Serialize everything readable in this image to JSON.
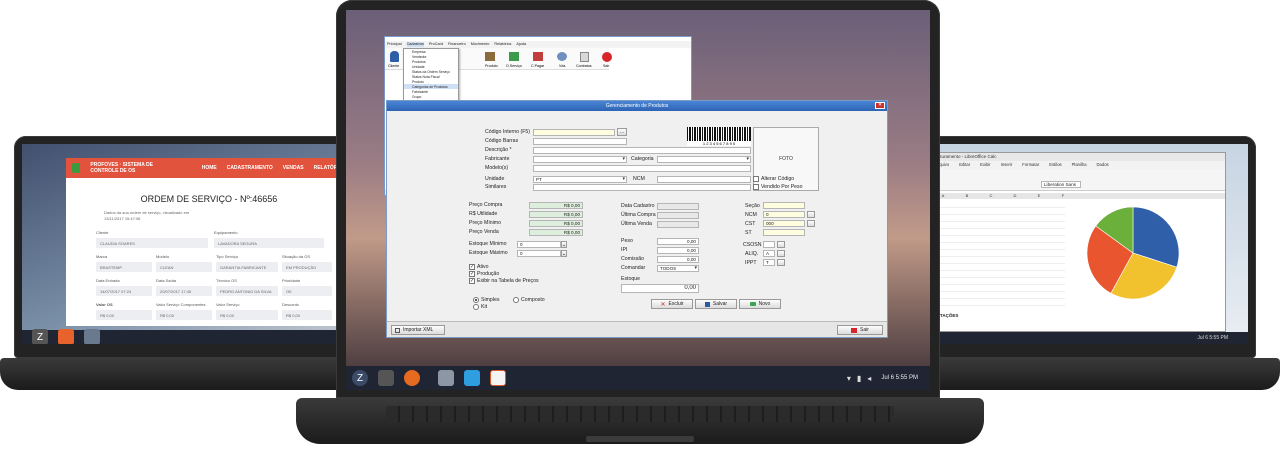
{
  "left_laptop": {
    "app": {
      "brand": "PROFOVES · SISTEMA DE CONTROLE DE OS",
      "nav": [
        "HOME",
        "CADASTRAMENTO",
        "VENDAS",
        "RELATÓRIOS"
      ],
      "title": "ORDEM DE SERVIÇO - Nº:46656",
      "subtitle": "Dados da sua ordem de serviço, visualizado em 13/11/2017 15:47:06",
      "fields": [
        {
          "label": "Cliente",
          "value": "CLAUDIA SOARES"
        },
        {
          "label": "Equipamento",
          "value": "LAVADORA SEGURA"
        },
        {
          "label": "Marca",
          "value": "BRASTEMP"
        },
        {
          "label": "Modelo",
          "value": "CLEAN"
        },
        {
          "label": "Tipo Serviço",
          "value": "GARANTIA FABRICANTE"
        },
        {
          "label": "Situação da OS",
          "value": "EM PRODUÇÃO"
        },
        {
          "label": "Data Entrada",
          "value": "14/07/2017 07:24"
        },
        {
          "label": "Data Saída",
          "value": "20/07/2017 17:45"
        },
        {
          "label": "Técnico OS",
          "value": "PEDRO ANTONIO DA SILVA"
        },
        {
          "label": "Prioridade",
          "value": "OK"
        },
        {
          "label": "Valor OS",
          "value": "R$ 0,00"
        },
        {
          "label": "Valor Serviço Componentes",
          "value": "R$ 0,00"
        },
        {
          "label": "Valor Serviço",
          "value": "R$ 0,00"
        },
        {
          "label": "Desconto",
          "value": "R$ 0,00"
        }
      ]
    }
  },
  "center_laptop": {
    "main_window": {
      "menu": [
        "Principal",
        "Cadastros",
        "ProCard",
        "Financeiro",
        "Movimento",
        "Relatórios",
        "Ajuda"
      ],
      "dropdown": [
        "Empresa",
        "Vendedor",
        "Produtos",
        "Unidade",
        "Status da Ordem Serviço",
        "Status Nota Fiscal",
        "Produto",
        "Categorias de Produtos",
        "Fabricante",
        "Grupo",
        "Tipo de Serviço",
        "Serviço"
      ],
      "toolbar": [
        "Cliente",
        "Produto",
        "O.Serviço",
        "C.Pagar",
        "Vda",
        "Contratos",
        "Sair"
      ],
      "status": "UN. MINAS CONTAS"
    },
    "dialog": {
      "title": "Gerenciamento de Produtos",
      "labels": {
        "codigo_interno": "Código Interno (F5)",
        "codigo_barras": "Código Barras",
        "descricao": "Descrição *",
        "fabricante": "Fabricante",
        "categoria": "Categoria",
        "modelo": "Modelo(s)",
        "unidade": "Unidade",
        "ncm": "NCM",
        "similares": "Similares",
        "foto": "FOTO",
        "barcode_number": "1 2 3 4 5 6 7 8 9 0",
        "alterar_codigo": "Alterar Código",
        "vendido_peso": "Vendido Por Peso",
        "preco_compra": "Preço Compra",
        "rs_utilidade": "R$ Utilidade",
        "preco_minimo": "Preço Mínimo",
        "preco_venda": "Preço Venda",
        "ultimo_cadastro": "Data Cadastro",
        "ultima_compra": "Última Compra",
        "ultima_venda": "Última Venda",
        "sessao": "Seção",
        "ncm2": "NCM",
        "cst": "CST",
        "st": "ST",
        "estoque_min": "Estoque Mínimo",
        "estoque_max": "Estoque Máximo",
        "peso": "Peso",
        "ipi": "IPI",
        "comissao": "Comissão",
        "comandar": "Comandar",
        "estoque": "Estoque",
        "cfop": "CSOSN",
        "icms": "ALIQ.",
        "ippt": "IPPT",
        "ativo": "Ativo",
        "producao": "Produção",
        "exibir_tabela": "Exibir na Tabela de Preços",
        "simples": "Simples",
        "composto": "Composto",
        "kit": "Kit",
        "importar_xml": "Importar XML"
      },
      "values": {
        "unidade": "PT",
        "preco_compra": "R$ 0,00",
        "rs_utilidade": "R$ 0,00",
        "preco_minimo": "R$ 0,00",
        "preco_venda": "R$ 0,00",
        "estoque_min": "0",
        "estoque_max": "0",
        "peso": "0,00",
        "ipi": "0,00",
        "comissao": "0,00",
        "comandar": "TODOS",
        "estoque": "0,00",
        "ncm2": "0",
        "cst": "000",
        "icms": "A",
        "ippt": "T"
      },
      "buttons": {
        "excluir": "Excluir",
        "salvar": "Salvar",
        "novo": "Novo",
        "sair": "Sair"
      }
    },
    "taskbar": {
      "time": "Jul 6   5:55 PM"
    }
  },
  "right_laptop": {
    "sheet": {
      "title": "Faturamento - LibreOffice Calc",
      "menu": [
        "Arquivo",
        "Editar",
        "Exibir",
        "Inserir",
        "Formatar",
        "Estilos",
        "Planilha",
        "Dados",
        "Ferramentas",
        "Janela",
        "Ajuda"
      ],
      "font": "Liberation Sans",
      "col_headers": [
        "A",
        "B",
        "C",
        "D",
        "E",
        "F"
      ],
      "footer_label": "ATAÇÕES",
      "time": "Jul 6   5:55 PM"
    },
    "chart_data": {
      "type": "pie",
      "values": [
        30,
        28,
        27,
        15
      ],
      "colors": [
        "#2f5fa8",
        "#f2c12e",
        "#e8552e",
        "#6bb03a"
      ]
    }
  }
}
